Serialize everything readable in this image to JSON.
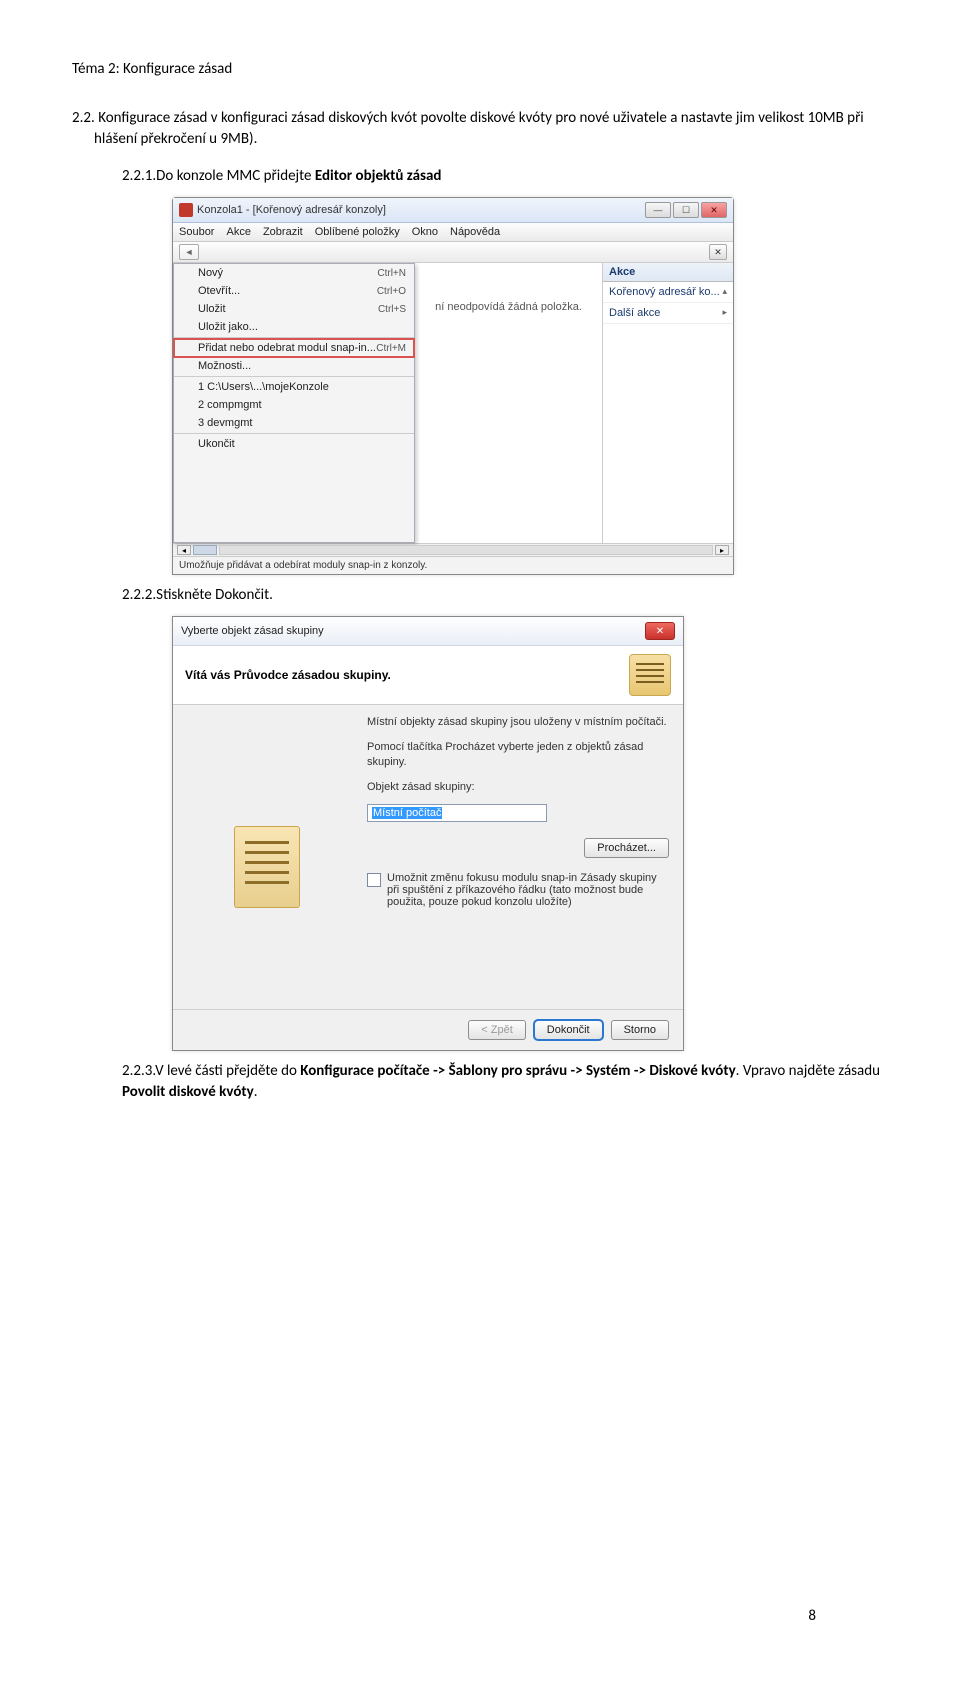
{
  "header": "Téma 2: Konfigurace zásad",
  "section": {
    "num": "2.2.",
    "text_lead": "Konfigurace zásad v konfiguraci zásad diskových kvót povolte diskové kvóty pro nové uživatele a nastavte jim velikost 10MB při hlášení překročení u 9MB)."
  },
  "step1": {
    "num": "2.2.1.",
    "text_pre": "Do konzole MMC přidejte ",
    "text_bold": "Editor objektů zásad"
  },
  "mmc": {
    "title": "Konzola1 - [Kořenový adresář konzoly]",
    "menubar": [
      "Soubor",
      "Akce",
      "Zobrazit",
      "Oblíbené položky",
      "Okno",
      "Nápověda"
    ],
    "menu": {
      "items": [
        {
          "label": "Nový",
          "shortcut": "Ctrl+N"
        },
        {
          "label": "Otevřít...",
          "shortcut": "Ctrl+O"
        },
        {
          "label": "Uložit",
          "shortcut": "Ctrl+S"
        },
        {
          "label": "Uložit jako..."
        },
        {
          "sep": true
        },
        {
          "label": "Přidat nebo odebrat modul snap-in...",
          "shortcut": "Ctrl+M",
          "highlight": true
        },
        {
          "label": "Možnosti..."
        },
        {
          "sep": true
        },
        {
          "label": "1 C:\\Users\\...\\mojeKonzole"
        },
        {
          "label": "2 compmgmt"
        },
        {
          "label": "3 devmgmt"
        },
        {
          "sep": true
        },
        {
          "label": "Ukončit"
        }
      ]
    },
    "center_text": "ní neodpovídá žádná položka.",
    "actions_header": "Akce",
    "actions_row1": "Kořenový adresář ko...",
    "actions_row2": "Další akce",
    "status": "Umožňuje přidávat a odebírat moduly snap-in z konzoly."
  },
  "step2": {
    "num": "2.2.2.",
    "text": "Stiskněte Dokončit."
  },
  "wiz": {
    "title": "Vyberte objekt zásad skupiny",
    "banner": "Vítá vás Průvodce zásadou skupiny.",
    "p1": "Místní objekty zásad skupiny jsou uloženy v místním počítači.",
    "p2": "Pomocí tlačítka Procházet vyberte jeden z objektů zásad skupiny.",
    "field_label": "Objekt zásad skupiny:",
    "field_value": "Místní počítač",
    "browse": "Procházet...",
    "checkbox": "Umožnit změnu fokusu modulu snap-in Zásady skupiny při spuštění z příkazového řádku (tato možnost bude použita, pouze pokud konzolu uložíte)",
    "back": "< Zpět",
    "finish": "Dokončit",
    "cancel": "Storno"
  },
  "step3": {
    "num": "2.2.3.",
    "text_pre": "V levé části přejděte do ",
    "bold1": "Konfigurace počítače -> Šablony pro správu -> Systém -> Diskové kvóty",
    "text_mid": ". Vpravo najděte zásadu ",
    "bold2": "Povolit diskové kvóty",
    "text_end": "."
  },
  "page_number": "8"
}
